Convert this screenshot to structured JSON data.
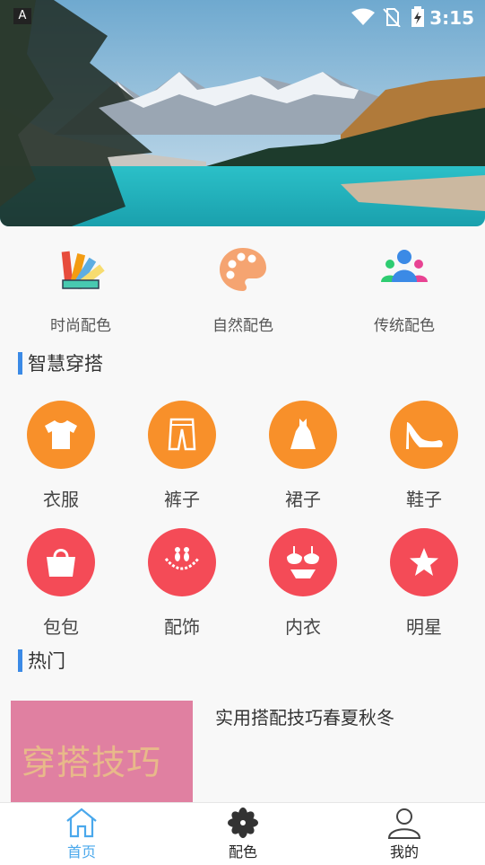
{
  "status_bar": {
    "time": "3:15",
    "left_icon": "A"
  },
  "categories": [
    {
      "label": "时尚配色",
      "icon": "color-swatch-icon"
    },
    {
      "label": "自然配色",
      "icon": "palette-icon"
    },
    {
      "label": "传统配色",
      "icon": "people-group-icon"
    }
  ],
  "smart_outfit": {
    "title": "智慧穿搭",
    "items": [
      {
        "label": "衣服",
        "icon": "tshirt-icon"
      },
      {
        "label": "裤子",
        "icon": "pants-icon"
      },
      {
        "label": "裙子",
        "icon": "dress-icon"
      },
      {
        "label": "鞋子",
        "icon": "high-heel-icon"
      },
      {
        "label": "包包",
        "icon": "handbag-icon"
      },
      {
        "label": "配饰",
        "icon": "necklace-icon"
      },
      {
        "label": "内衣",
        "icon": "bra-icon"
      },
      {
        "label": "明星",
        "icon": "star-icon"
      }
    ]
  },
  "hot": {
    "title": "热门",
    "article": {
      "title": "实用搭配技巧春夏秋冬",
      "thumb_text": "穿搭技巧"
    }
  },
  "tabbar": {
    "items": [
      {
        "label": "首页",
        "active": true
      },
      {
        "label": "配色",
        "active": false
      },
      {
        "label": "我的",
        "active": false
      }
    ]
  },
  "colors": {
    "accent": "#3b8ae6",
    "orange": "#f8902a",
    "red": "#f44b57",
    "tab_active": "#4aa8ec",
    "thumb_bg": "#e080a1"
  }
}
